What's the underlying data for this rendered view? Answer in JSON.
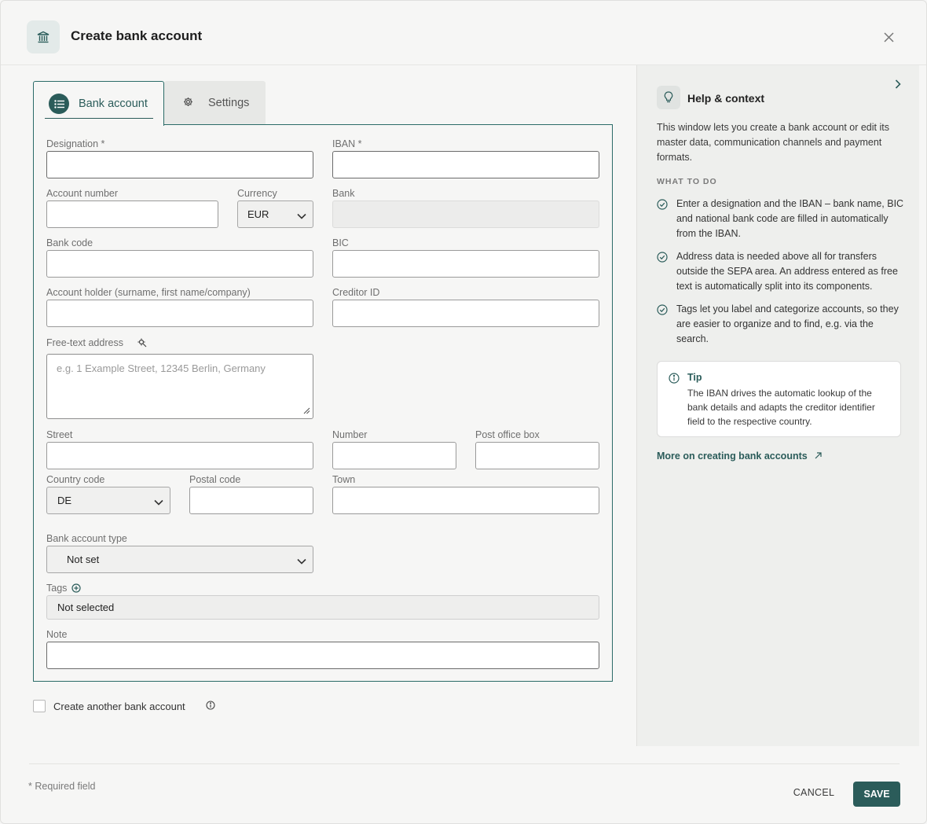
{
  "header": {
    "title": "Create bank account",
    "icon": "bank-icon",
    "close_icon": "close-icon"
  },
  "tabs": [
    {
      "label": "Bank account",
      "icon": "list-icon",
      "active": true
    },
    {
      "label": "Settings",
      "icon": "gear-icon",
      "active": false
    }
  ],
  "form": {
    "designation_label": "Designation *",
    "iban_label": "IBAN *",
    "account_number_label": "Account number",
    "currency_label": "Currency",
    "currency_value": "EUR",
    "bank_label": "Bank",
    "bank_code_label": "Bank code",
    "bic_label": "BIC",
    "account_holder_label": "Account holder (surname, first name/company)",
    "creditor_id_label": "Creditor ID",
    "free_text_label": "Free-text address",
    "free_text_placeholder": "e.g. 1 Example Street, 12345 Berlin, Germany",
    "street_label": "Street",
    "number_label": "Number",
    "po_box_label": "Post office box",
    "country_code_label": "Country code",
    "country_code_value": "DE",
    "postal_code_label": "Postal code",
    "town_label": "Town",
    "account_type_label": "Bank account type",
    "account_type_value": "Not set",
    "tags_label": "Tags",
    "tags_value": "Not selected",
    "note_label": "Note"
  },
  "create_another": {
    "label": "Create another bank account",
    "checked": false
  },
  "help": {
    "title": "Help & context",
    "intro": "This window lets you create a bank account or edit its master data, communication channels and payment formats.",
    "what_to_do": "WHAT TO DO",
    "items": [
      "Enter a designation and the IBAN – bank name, BIC and national bank code are filled in automatically from the IBAN.",
      "Address data is needed above all for transfers outside the SEPA area. An address entered as free text is automatically split into its components.",
      "Tags let you label and categorize accounts, so they are easier to organize and to find, e.g. via the search."
    ],
    "tip_title": "Tip",
    "tip_text": "The IBAN drives the automatic lookup of the bank details and adapts the creditor identifier field to the respective country.",
    "link": "More on creating bank accounts"
  },
  "footer": {
    "required_note": "* Required field",
    "cancel": "CANCEL",
    "save": "SAVE"
  },
  "colors": {
    "accent": "#2b5c5a",
    "background": "#f6f6f5",
    "help_bg": "#eeefed"
  }
}
